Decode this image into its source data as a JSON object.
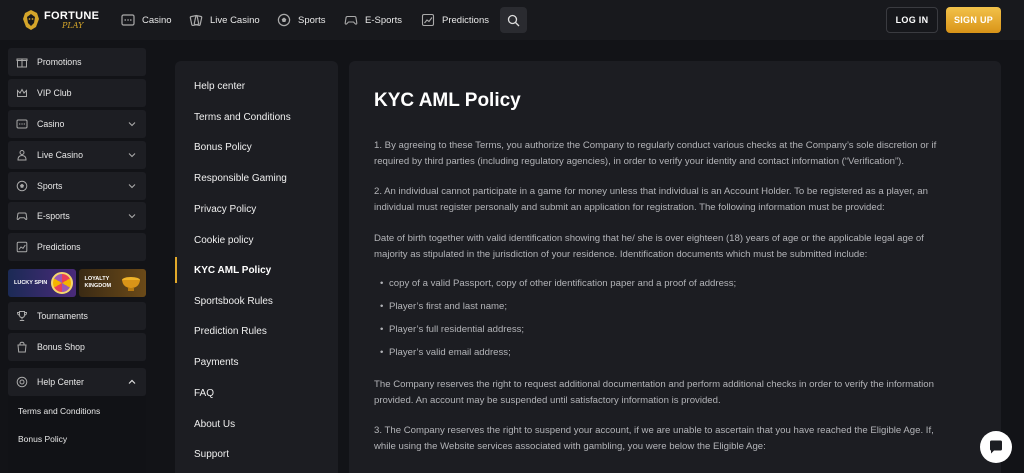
{
  "brand": {
    "name_top": "FORTUNE",
    "name_bottom": "PLAY"
  },
  "topnav": [
    {
      "label": "Casino",
      "icon": "slot-machine-icon"
    },
    {
      "label": "Live Casino",
      "icon": "dealer-icon"
    },
    {
      "label": "Sports",
      "icon": "soccer-ball-icon"
    },
    {
      "label": "E-Sports",
      "icon": "gamepad-icon"
    },
    {
      "label": "Predictions",
      "icon": "chart-icon"
    }
  ],
  "auth": {
    "login_label": "LOG IN",
    "signup_label": "SIGN UP"
  },
  "sidebar": {
    "items": [
      {
        "label": "Promotions",
        "icon": "gift-icon"
      },
      {
        "label": "VIP Club",
        "icon": "crown-icon"
      },
      {
        "label": "Casino",
        "icon": "slot-machine-icon"
      },
      {
        "label": "Live Casino",
        "icon": "dealer-icon"
      },
      {
        "label": "Sports",
        "icon": "soccer-ball-icon"
      },
      {
        "label": "E-sports",
        "icon": "gamepad-icon"
      },
      {
        "label": "Predictions",
        "icon": "chart-icon"
      },
      {
        "label": "Tournaments",
        "icon": "trophy-icon"
      },
      {
        "label": "Bonus Shop",
        "icon": "shopping-bag-icon"
      },
      {
        "label": "Help Center",
        "icon": "lifebuoy-icon"
      }
    ],
    "promos": [
      {
        "label": "LUCKY SPIN"
      },
      {
        "label_line1": "LOYALTY",
        "label_line2": "KINGDOM"
      }
    ],
    "help_sub": [
      "Terms and Conditions",
      "Bonus Policy"
    ]
  },
  "help_nav": [
    "Help center",
    "Terms and Conditions",
    "Bonus Policy",
    "Responsible Gaming",
    "Privacy Policy",
    "Cookie policy",
    "KYC AML Policy",
    "Sportsbook Rules",
    "Prediction Rules",
    "Payments",
    "FAQ",
    "About Us",
    "Support"
  ],
  "help_nav_active": "KYC AML Policy",
  "content": {
    "title": "KYC AML Policy",
    "p1_l1": "1. By agreeing to these Terms, you authorize the Company to regularly conduct various checks at the Company’s sole discretion or if",
    "p1_l2": "required by third parties (including regulatory agencies), in order to verify your identity and contact information (“Verification”).",
    "p2_l1": "2. An individual cannot participate in a game for money unless that individual is an Account Holder. To be registered as a player, an",
    "p2_l2": "individual must register personally and submit an application for registration. The following information must be provided:",
    "p3_l1": "Date of birth together with valid identification showing that he/ she is over eighteen (18) years of age or the applicable legal age of",
    "p3_l2": "majority as stipulated in the jurisdiction of your residence. Identification documents which must be submitted include:",
    "bullets": [
      "copy of a valid Passport, copy of other identification paper and a proof of address;",
      "Player’s first and last name;",
      "Player’s full residential address;",
      "Player’s valid email address;"
    ],
    "p4_l1": "The Company reserves the right to request additional documentation and perform additional checks in order to verify the information",
    "p4_l2": "provided. An account may be suspended until satisfactory information is provided.",
    "p5_l1": "3. The Company reserves the right to suspend your account, if we are unable to ascertain that you have reached the Eligible Age. If,",
    "p5_l2": "while using the Website services associated with gambling, you were below the Eligible Age:"
  },
  "colors": {
    "accent": "#e2a92a",
    "panel": "#1c1d22",
    "background": "#121317"
  }
}
